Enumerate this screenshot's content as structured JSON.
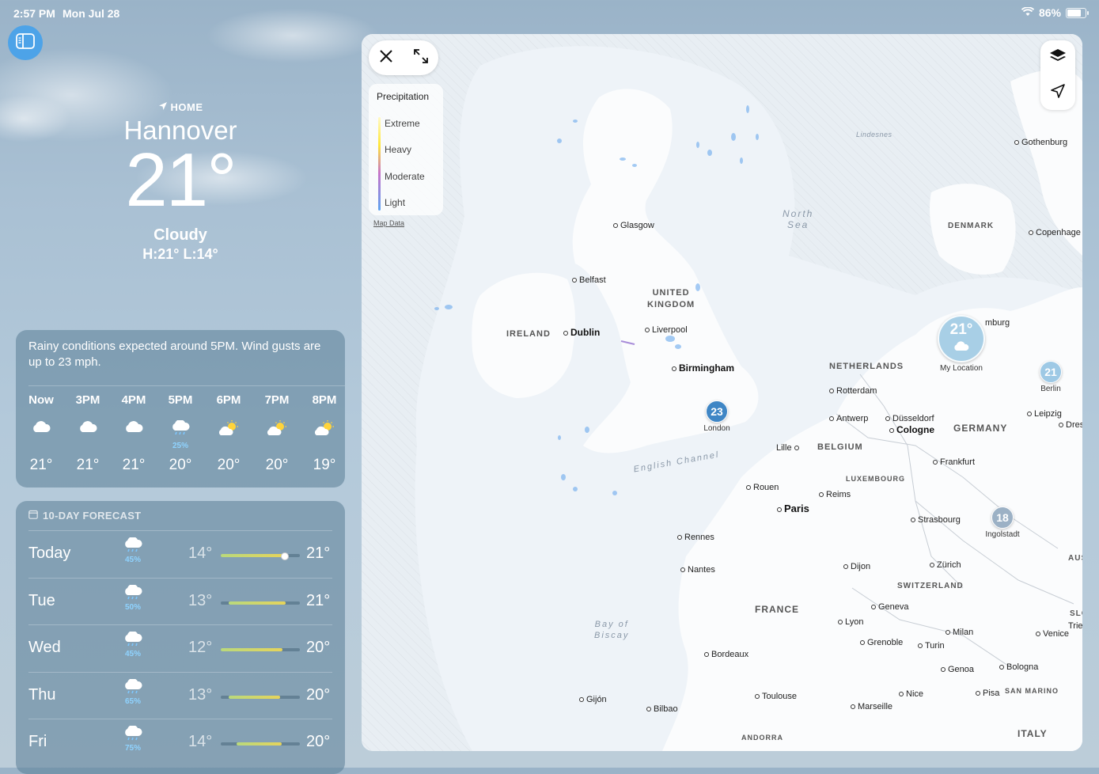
{
  "status": {
    "time": "2:57 PM",
    "date": "Mon Jul 28",
    "battery": "86%",
    "battery_level": 0.86
  },
  "current": {
    "home_label": "HOME",
    "city": "Hannover",
    "temp": "21°",
    "condition": "Cloudy",
    "hilo": "H:21°  L:14°"
  },
  "hourly": {
    "summary": "Rainy conditions expected around 5PM. Wind gusts are up to 23 mph.",
    "hours": [
      {
        "label": "Now",
        "icon": "cloud-icon",
        "pct": "",
        "temp": "21°"
      },
      {
        "label": "3PM",
        "icon": "cloud-icon",
        "pct": "",
        "temp": "21°"
      },
      {
        "label": "4PM",
        "icon": "cloud-icon",
        "pct": "",
        "temp": "21°"
      },
      {
        "label": "5PM",
        "icon": "rain-icon",
        "pct": "25%",
        "temp": "20°"
      },
      {
        "label": "6PM",
        "icon": "partly-sunny-icon",
        "pct": "",
        "temp": "20°"
      },
      {
        "label": "7PM",
        "icon": "partly-sunny-icon",
        "pct": "",
        "temp": "20°"
      },
      {
        "label": "8PM",
        "icon": "partly-sunny-icon",
        "pct": "",
        "temp": "19°"
      }
    ]
  },
  "daily": {
    "header": "10-DAY FORECAST",
    "days": [
      {
        "name": "Today",
        "pct": "45%",
        "low": "14°",
        "high": "21°",
        "bar_start": 0.0,
        "bar_end": 0.8,
        "current": 0.8
      },
      {
        "name": "Tue",
        "pct": "50%",
        "low": "13°",
        "high": "21°",
        "bar_start": 0.1,
        "bar_end": 0.82
      },
      {
        "name": "Wed",
        "pct": "45%",
        "low": "12°",
        "high": "20°",
        "bar_start": 0.0,
        "bar_end": 0.78
      },
      {
        "name": "Thu",
        "pct": "65%",
        "low": "13°",
        "high": "20°",
        "bar_start": 0.1,
        "bar_end": 0.75
      },
      {
        "name": "Fri",
        "pct": "75%",
        "low": "14°",
        "high": "20°",
        "bar_start": 0.2,
        "bar_end": 0.77
      }
    ]
  },
  "map": {
    "legend_title": "Precipitation",
    "legend": [
      "Extreme",
      "Heavy",
      "Moderate",
      "Light"
    ],
    "map_data": "Map Data",
    "cities": {
      "glasgow": "Glasgow",
      "belfast": "Belfast",
      "dublin": "Dublin",
      "liverpool": "Liverpool",
      "birmingham": "Birmingham",
      "rotterdam": "Rotterdam",
      "antwerp": "Antwerp",
      "dusseldorf": "Düsseldorf",
      "cologne": "Cologne",
      "lille": "Lille",
      "frankfurt": "Frankfurt",
      "rouen": "Rouen",
      "paris": "Paris",
      "reims": "Reims",
      "strasbourg": "Strasbourg",
      "rennes": "Rennes",
      "nantes": "Nantes",
      "dijon": "Dijon",
      "zurich": "Zürich",
      "geneva": "Geneva",
      "lyon": "Lyon",
      "grenoble": "Grenoble",
      "turin": "Turin",
      "milan": "Milan",
      "venice": "Venice",
      "trieste": "Tries",
      "genoa": "Genoa",
      "bologna": "Bologna",
      "bordeaux": "Bordeaux",
      "toulouse": "Toulouse",
      "marseille": "Marseille",
      "nice": "Nice",
      "pisa": "Pisa",
      "gijon": "Gijón",
      "bilbao": "Bilbao",
      "gothenburg": "Gothenburg",
      "copenhagen": "Copenhage",
      "hamburg": "mburg",
      "leipzig": "Leipzig",
      "dresden": "Dres"
    },
    "countries": {
      "uk": "UNITED\nKINGDOM",
      "ireland": "IRELAND",
      "netherlands": "NETHERLANDS",
      "belgium": "BELGIUM",
      "luxembourg": "LUXEMBOURG",
      "germany": "GERMANY",
      "denmark": "DENMARK",
      "france": "FRANCE",
      "switzerland": "SWITZERLAND",
      "italy": "ITALY",
      "andorra": "ANDORRA",
      "san_marino": "SAN MARINO",
      "slo": "SLO",
      "aus": "AUS"
    },
    "seas": {
      "north_sea": "North\nSea",
      "english_channel": "English Channel",
      "biscay": "Bay of\nBiscay",
      "lindesnes": "Lindesnes"
    },
    "pins": {
      "my_location": {
        "temp": "21°",
        "label": "My Location"
      },
      "london": {
        "temp": "23",
        "label": "London"
      },
      "berlin": {
        "temp": "21",
        "label": "Berlin"
      },
      "ingolstadt": {
        "temp": "18",
        "label": "Ingolstadt"
      }
    }
  }
}
